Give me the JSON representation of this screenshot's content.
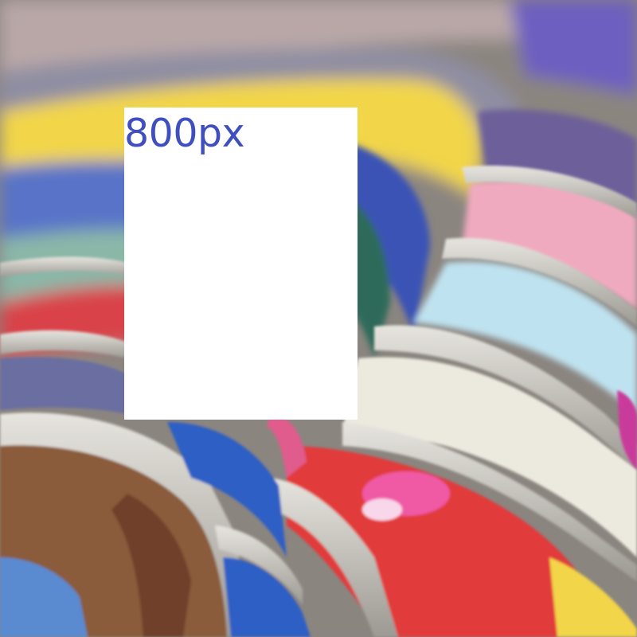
{
  "image": {
    "subject": "magazines",
    "overlay": {
      "label": "800px",
      "label_color": "#3f4fbf",
      "background": "#ffffff"
    },
    "palette": {
      "yellow": "#f2d54a",
      "purple": "#6d5fc0",
      "pink": "#f0aac0",
      "lightblue": "#bfe2f0",
      "red": "#e23b3b",
      "blue": "#2f5fc5",
      "brown": "#8a5b3a",
      "page-edge": "#cfcfc9"
    }
  }
}
